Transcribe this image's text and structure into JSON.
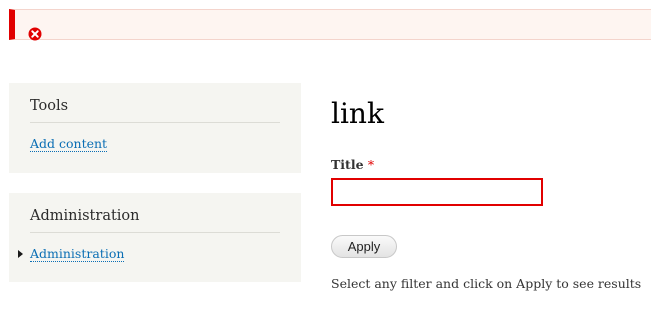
{
  "error_message": {
    "icon": "error-x-icon",
    "accent_color": "#e10000",
    "background_color": "#fef5f1"
  },
  "sidebar": {
    "tools": {
      "title": "Tools",
      "links": [
        {
          "label": "Add content"
        }
      ]
    },
    "administration": {
      "title": "Administration",
      "links": [
        {
          "label": "Administration",
          "icon": "collapsed-arrow-icon"
        }
      ]
    }
  },
  "main": {
    "page_title": "link",
    "title_field": {
      "label": "Title",
      "required_marker": "*",
      "value": "",
      "placeholder": ""
    },
    "apply_label": "Apply",
    "help_text": "Select any filter and click on Apply to see results"
  },
  "colors": {
    "link": "#0a6eb4",
    "required": "#e10000",
    "sidebar_background": "#f5f5f1"
  }
}
